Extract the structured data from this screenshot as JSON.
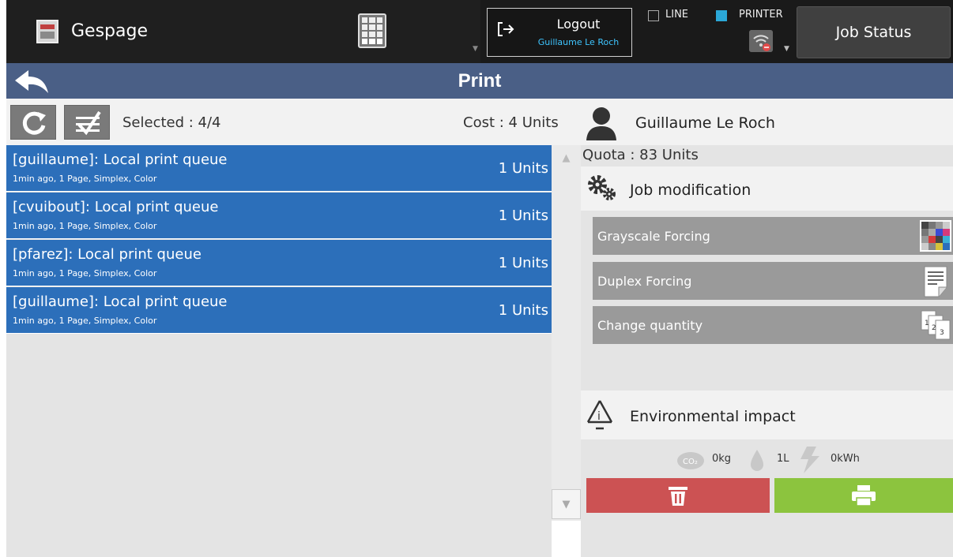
{
  "header": {
    "app_title": "Gespage",
    "logout_label": "Logout",
    "logout_user": "Guillaume Le Roch",
    "line_label": "LINE",
    "printer_label": "PRINTER",
    "job_status_label": "Job Status"
  },
  "page": {
    "title": "Print"
  },
  "toolbar": {
    "selected_text": "Selected : 4/4",
    "cost_text": "Cost : 4 Units",
    "user_name": "Guillaume Le Roch"
  },
  "jobs": [
    {
      "title": "[guillaume]: Local print queue",
      "meta": "1min ago, 1 Page, Simplex, Color",
      "cost": "1 Units"
    },
    {
      "title": "[cvuibout]: Local print queue",
      "meta": "1min ago, 1 Page, Simplex, Color",
      "cost": "1 Units"
    },
    {
      "title": "[pfarez]: Local print queue",
      "meta": "1min ago, 1 Page, Simplex, Color",
      "cost": "1 Units"
    },
    {
      "title": "[guillaume]: Local print queue",
      "meta": "1min ago, 1 Page, Simplex, Color",
      "cost": "1 Units"
    }
  ],
  "right_panel": {
    "quota_text": "Quota : 83 Units",
    "job_modification_label": "Job modification",
    "actions": [
      {
        "label": "Grayscale Forcing",
        "icon": "grayscale-icon"
      },
      {
        "label": "Duplex Forcing",
        "icon": "duplex-icon"
      },
      {
        "label": "Change quantity",
        "icon": "quantity-icon"
      }
    ],
    "environment_label": "Environmental impact",
    "environment": {
      "co2": "0kg",
      "water": "1L",
      "energy": "0kWh"
    }
  },
  "icons": {
    "app": "gespage-logo-icon",
    "keypad": "keypad-icon",
    "logout": "logout-icon",
    "wifi": "wifi-disabled-icon",
    "back": "back-arrow-icon",
    "refresh": "refresh-icon",
    "select_all": "select-all-icon",
    "user": "user-icon",
    "gear": "gear-icon",
    "recycle": "recycle-icon",
    "delete": "trash-icon",
    "print": "printer-icon"
  },
  "colors": {
    "topbar": "#1a1a1a",
    "titlebar": "#4a5f86",
    "job_selected": "#2c6fba",
    "delete_button": "#cc5253",
    "print_button": "#8cc43e",
    "logout_user": "#3ec5ff",
    "printer_status": "#2ba8d8"
  }
}
